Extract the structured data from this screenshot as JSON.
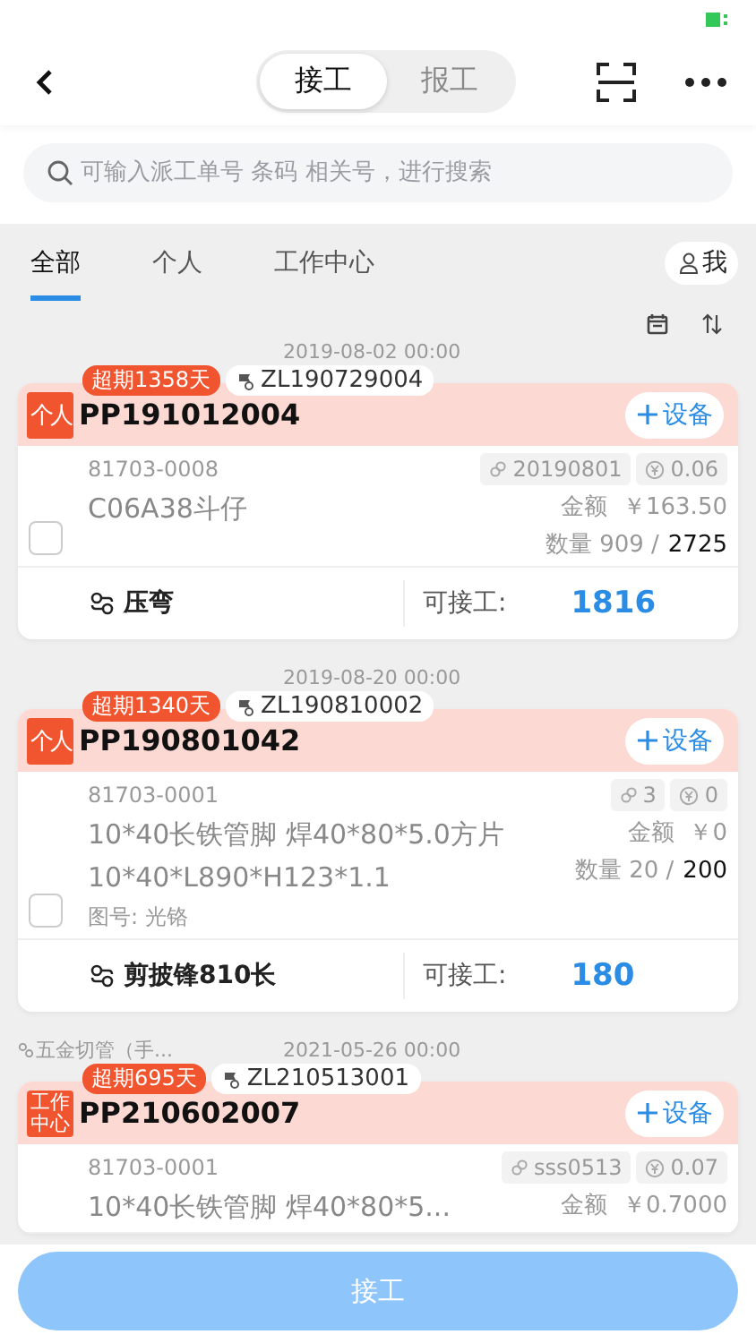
{
  "header": {
    "segments": [
      {
        "label": "接工",
        "selected": true
      },
      {
        "label": "报工",
        "selected": false
      }
    ]
  },
  "search": {
    "placeholder": "可输入派工单号 条码 相关号，进行搜索"
  },
  "tabs": [
    {
      "label": "全部",
      "selected": true
    },
    {
      "label": "个人",
      "selected": false
    },
    {
      "label": "工作中心",
      "selected": false
    }
  ],
  "me_filter": {
    "label": "我"
  },
  "cards": [
    {
      "date": "2019-08-02 00:00",
      "overdue": "超期1358天",
      "ref": "ZL190729004",
      "type_tag": "个人",
      "order_no": "PP191012004",
      "add_button": "设备",
      "code": "81703-0008",
      "name_lines": [
        "C06A38斗仔"
      ],
      "batch": "20190801",
      "coef": "0.06",
      "amount_label": "金额",
      "amount": "￥163.50",
      "qty_done": "数量 909 /",
      "qty_total": "2725",
      "checked": false,
      "process": "压弯",
      "available_label": "可接工:",
      "available": "1816"
    },
    {
      "date": "2019-08-20 00:00",
      "overdue": "超期1340天",
      "ref": "ZL190810002",
      "type_tag": "个人",
      "order_no": "PP190801042",
      "add_button": "设备",
      "code": "81703-0001",
      "name_lines": [
        "10*40长铁管脚 焊40*80*5.0方片",
        "10*40*L890*H123*1.1"
      ],
      "drawing_no": "图号: 光铬",
      "batch": "3",
      "coef": "0",
      "amount_label": "金额",
      "amount": "￥0",
      "qty_done": "数量 20 /",
      "qty_total": "200",
      "checked": false,
      "process": "剪披锋810长",
      "available_label": "可接工:",
      "available": "180"
    },
    {
      "group": "五金切管（手...",
      "date": "2021-05-26 00:00",
      "overdue": "超期695天",
      "ref": "ZL210513001",
      "type_tag": "工作中心",
      "order_no": "PP210602007",
      "add_button": "设备",
      "code": "81703-0001",
      "name_lines": [
        "10*40长铁管脚 焊40*80*5..."
      ],
      "batch": "sss0513",
      "coef": "0.07",
      "amount_label": "金额",
      "amount": "￥0.7000"
    }
  ],
  "submit_button": {
    "label": "接工",
    "disabled": true
  }
}
